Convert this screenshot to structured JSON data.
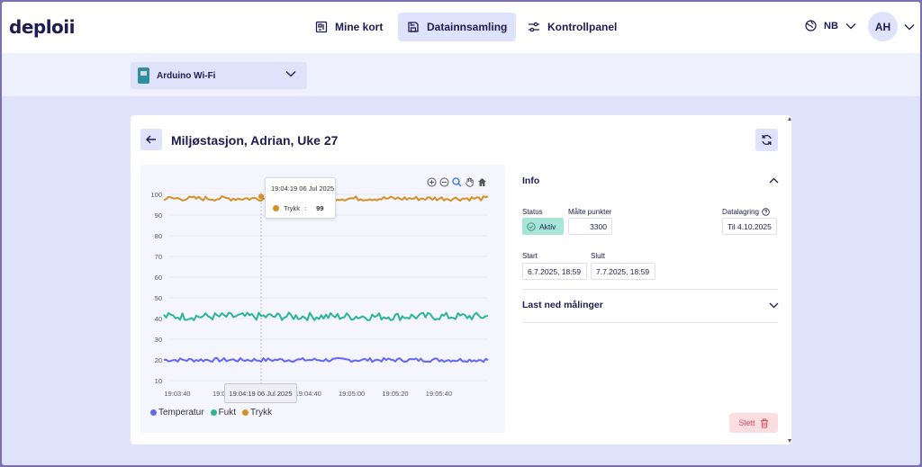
{
  "app": {
    "logo": "deploii"
  },
  "nav": {
    "items": [
      {
        "label": "Mine kort",
        "icon": "board-icon"
      },
      {
        "label": "Datainnsamling",
        "icon": "save-icon",
        "active": true
      },
      {
        "label": "Kontrollpanel",
        "icon": "sliders-icon"
      }
    ]
  },
  "language": {
    "code": "NB"
  },
  "user": {
    "initials": "AH"
  },
  "device_select": {
    "selected": "Arduino Wi-Fi"
  },
  "page": {
    "title": "Miljøstasjon, Adrian, Uke 27"
  },
  "chart_data": {
    "type": "line",
    "x": [
      "19:03:40",
      "19:04:00",
      "19:04:20",
      "19:04:40",
      "19:05:00",
      "19:05:20",
      "19:05:40"
    ],
    "xtick_visible": [
      "19:03:40",
      "19:04",
      "",
      "19:04:40",
      "19:05:00",
      "19:05:20",
      "19:05:40"
    ],
    "yticks": [
      10,
      20,
      30,
      40,
      50,
      60,
      70,
      80,
      90,
      100
    ],
    "ylim": [
      10,
      100
    ],
    "grid": true,
    "legend": "bottom-left",
    "series": [
      {
        "name": "Temperatur",
        "color": "#6466f1",
        "level": 20,
        "noise": 0.6
      },
      {
        "name": "Fukt",
        "color": "#2bb596",
        "level": 41,
        "noise": 1.2
      },
      {
        "name": "Trykk",
        "color": "#d48f25",
        "level": 98,
        "noise": 0.7
      }
    ],
    "tooltip": {
      "time": "19:04:19 06 Jul 2025",
      "series": "Trykk",
      "value": "99"
    },
    "crosshair_label": "19:04:19 06 Jul 2025"
  },
  "info": {
    "title": "Info",
    "status_label": "Status",
    "status_value": "Aktiv",
    "points_label": "Målte punkter",
    "points_value": "3300",
    "storage_label": "Datalagring",
    "storage_value": "Til 4.10.2025",
    "start_label": "Start",
    "start_value": "6.7.2025, 18:59",
    "end_label": "Slutt",
    "end_value": "7.7.2025, 18:59"
  },
  "download": {
    "title": "Last ned målinger"
  },
  "actions": {
    "delete_label": "Slett"
  }
}
